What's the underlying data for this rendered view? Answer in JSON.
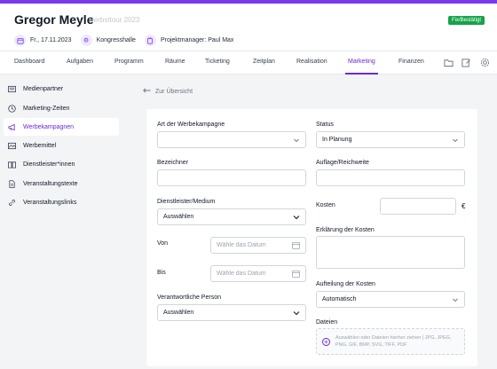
{
  "header": {
    "title": "Gregor Meyle",
    "subtitle": "Herbsttour 2023",
    "badge": "Fix/Bestätigt",
    "date": "Fr., 17.11.2023",
    "venue": "Kongresshalle",
    "project_manager": "Projektmanager: Paul Max"
  },
  "tabs": [
    "Dashboard",
    "Aufgaben",
    "Programm",
    "Räume",
    "Ticketing",
    "Zeitplan",
    "Realisation",
    "Marketing",
    "Finanzen"
  ],
  "active_tab": "Marketing",
  "tab_icons": [
    "folder-icon",
    "edit-icon",
    "settings-icon"
  ],
  "sidebar": {
    "items": [
      {
        "label": "Medienpartner",
        "icon": "newspaper-icon"
      },
      {
        "label": "Marketing-Zeiten",
        "icon": "clock-icon"
      },
      {
        "label": "Werbekampagnen",
        "icon": "megaphone-icon"
      },
      {
        "label": "Werbemittel",
        "icon": "image-icon"
      },
      {
        "label": "Dienstleister*innen",
        "icon": "book-icon"
      },
      {
        "label": "Veranstaltungstexte",
        "icon": "document-icon"
      },
      {
        "label": "Veranstaltungslinks",
        "icon": "link-icon"
      }
    ],
    "active": "Werbekampagnen"
  },
  "back_link": "Zur Übersicht",
  "form": {
    "art_label": "Art der Werbekampagne",
    "art_value": "",
    "status_label": "Status",
    "status_value": "In Planung",
    "bezeichner_label": "Bezeichner",
    "bezeichner_value": "",
    "auflage_label": "Auflage/Reichweite",
    "auflage_value": "",
    "dienstleister_label": "Dienstleister/Medium",
    "dienstleister_value": "Auswählen",
    "kosten_label": "Kosten",
    "kosten_value": "",
    "currency": "€",
    "von_label": "Von",
    "von_placeholder": "Wähle das Datum",
    "bis_label": "Bis",
    "bis_placeholder": "Wähle das Datum",
    "erklaerung_label": "Erklärung der Kosten",
    "erklaerung_value": "",
    "verantwortlich_label": "Verantwortliche Person",
    "verantwortlich_value": "Auswählen",
    "aufteilung_label": "Aufteilung der Kosten",
    "aufteilung_value": "Automatisch",
    "dateien_label": "Dateien",
    "upload_text": "Auswählen oder Dateien hierher ziehen | JPG, JPEG, PNG, GIF, BMP, SVG, TIFF, PDF"
  },
  "colors": {
    "accent": "#6d28d9",
    "badge": "#16a34a"
  }
}
